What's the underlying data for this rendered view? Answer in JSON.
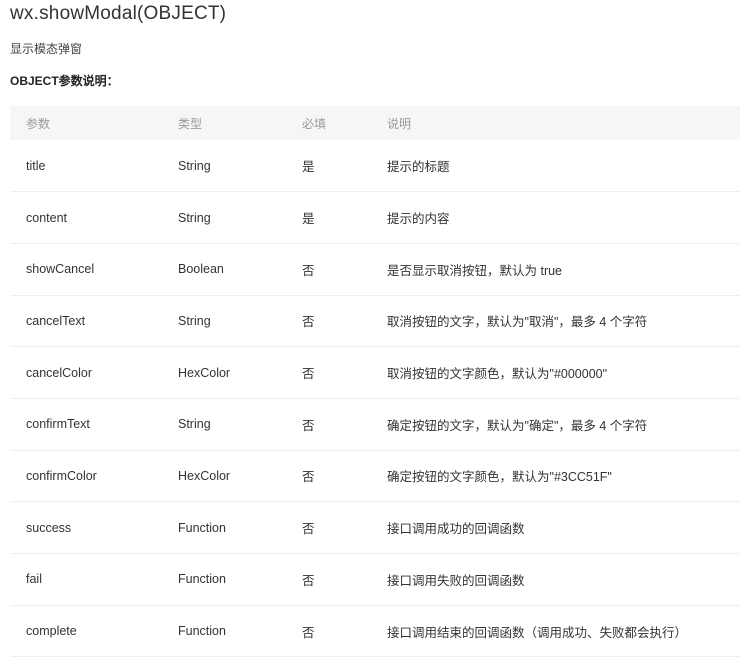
{
  "doc": {
    "title": "wx.showModal(OBJECT)",
    "subtitle": "显示模态弹窗",
    "section_heading": "OBJECT参数说明："
  },
  "table": {
    "headers": {
      "param": "参数",
      "type": "类型",
      "required": "必填",
      "desc": "说明"
    },
    "rows": [
      {
        "param": "title",
        "type": "String",
        "required": "是",
        "desc": "提示的标题"
      },
      {
        "param": "content",
        "type": "String",
        "required": "是",
        "desc": "提示的内容"
      },
      {
        "param": "showCancel",
        "type": "Boolean",
        "required": "否",
        "desc": "是否显示取消按钮，默认为 true"
      },
      {
        "param": "cancelText",
        "type": "String",
        "required": "否",
        "desc": "取消按钮的文字，默认为\"取消\"，最多 4 个字符"
      },
      {
        "param": "cancelColor",
        "type": "HexColor",
        "required": "否",
        "desc": "取消按钮的文字颜色，默认为\"#000000\""
      },
      {
        "param": "confirmText",
        "type": "String",
        "required": "否",
        "desc": "确定按钮的文字，默认为\"确定\"，最多 4 个字符"
      },
      {
        "param": "confirmColor",
        "type": "HexColor",
        "required": "否",
        "desc": "确定按钮的文字颜色，默认为\"#3CC51F\""
      },
      {
        "param": "success",
        "type": "Function",
        "required": "否",
        "desc": "接口调用成功的回调函数"
      },
      {
        "param": "fail",
        "type": "Function",
        "required": "否",
        "desc": "接口调用失败的回调函数"
      },
      {
        "param": "complete",
        "type": "Function",
        "required": "否",
        "desc": "接口调用结束的回调函数（调用成功、失败都会执行）"
      }
    ]
  },
  "colors": {
    "header_bg": "#f5f6f8",
    "header_text": "#9a9a9a",
    "body_text": "#333333",
    "row_border": "#eeeeee"
  }
}
